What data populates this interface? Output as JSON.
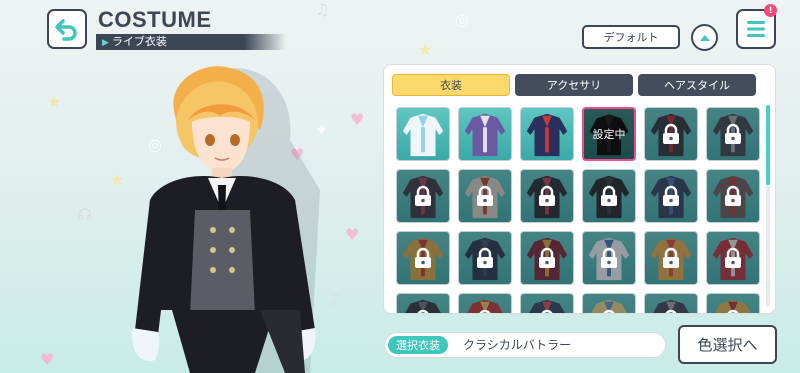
{
  "header": {
    "title": "COSTUME",
    "subtitle": "ライブ衣装",
    "default_button": "デフォルト",
    "menu_badge": "!"
  },
  "tabs": [
    {
      "label": "衣装",
      "active": true
    },
    {
      "label": "アクセサリ",
      "active": false
    },
    {
      "label": "ヘアスタイル",
      "active": false
    }
  ],
  "costumes": [
    {
      "colors": [
        "#eef5fb",
        "#8fd0ea"
      ],
      "locked": false,
      "selected": false
    },
    {
      "colors": [
        "#6a5aa4",
        "#e6e0f2"
      ],
      "locked": false,
      "selected": false
    },
    {
      "colors": [
        "#2b2f5e",
        "#c43a3a"
      ],
      "locked": false,
      "selected": false
    },
    {
      "colors": [
        "#1e1f24",
        "#3a3a40"
      ],
      "locked": false,
      "selected": true
    },
    {
      "colors": [
        "#2a2a30",
        "#b0212f"
      ],
      "locked": true,
      "selected": false
    },
    {
      "colors": [
        "#3b3d44",
        "#9ea2aa"
      ],
      "locked": true,
      "selected": false
    },
    {
      "colors": [
        "#3a2e3e",
        "#a6394e"
      ],
      "locked": true,
      "selected": false
    },
    {
      "colors": [
        "#d8d0c2",
        "#c0392b"
      ],
      "locked": true,
      "selected": false
    },
    {
      "colors": [
        "#1f2128",
        "#b33c4c"
      ],
      "locked": true,
      "selected": false
    },
    {
      "colors": [
        "#1c1d22",
        "#2f3038"
      ],
      "locked": true,
      "selected": false
    },
    {
      "colors": [
        "#2c3558",
        "#3f6aa4"
      ],
      "locked": true,
      "selected": false
    },
    {
      "colors": [
        "#6b5450",
        "#b0322d"
      ],
      "locked": true,
      "selected": false
    },
    {
      "colors": [
        "#d9a43b",
        "#c5322f"
      ],
      "locked": true,
      "selected": false
    },
    {
      "colors": [
        "#1f2e46",
        "#364966"
      ],
      "locked": true,
      "selected": false
    },
    {
      "colors": [
        "#7a1e2e",
        "#d7a536"
      ],
      "locked": true,
      "selected": false
    },
    {
      "colors": [
        "#eef2f6",
        "#3f6fb7"
      ],
      "locked": true,
      "selected": false
    },
    {
      "colors": [
        "#e9a63d",
        "#d24a3a"
      ],
      "locked": true,
      "selected": false
    },
    {
      "colors": [
        "#b62a37",
        "#f0e6e0"
      ],
      "locked": true,
      "selected": false
    },
    {
      "colors": [
        "#2d2e36",
        "#6a6d78"
      ],
      "locked": true,
      "selected": false
    },
    {
      "colors": [
        "#c13131",
        "#f2c35c"
      ],
      "locked": true,
      "selected": false
    },
    {
      "colors": [
        "#2a3c5a",
        "#d14c4c"
      ],
      "locked": true,
      "selected": false
    },
    {
      "colors": [
        "#f0d27a",
        "#5b8ed1"
      ],
      "locked": true,
      "selected": false
    },
    {
      "colors": [
        "#3a3f4c",
        "#9aa0ab"
      ],
      "locked": true,
      "selected": false
    },
    {
      "colors": [
        "#e4b04b",
        "#a6323a"
      ],
      "locked": true,
      "selected": false
    }
  ],
  "lock_icon": "padlock-icon",
  "selected_overlay_text": "設定中",
  "footer": {
    "selected_label": "選択衣装",
    "selected_name": "クラシカルバトラー",
    "color_button": "色選択へ"
  },
  "colors": {
    "accent_teal": "#3fc7bd",
    "active_tab": "#fbd96a",
    "dark_tab": "#444d5e",
    "selected_border": "#f04b8c",
    "outline": "#3c4655"
  }
}
